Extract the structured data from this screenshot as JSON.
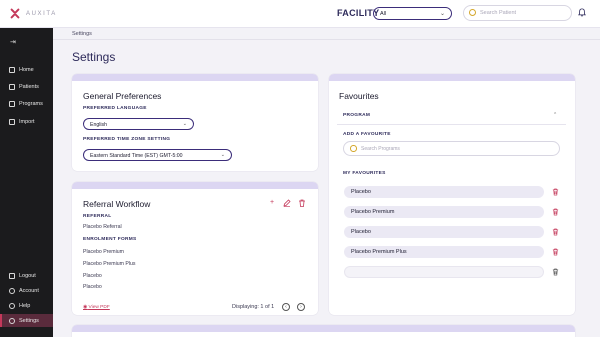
{
  "app": {
    "logo_text": "AUXITA"
  },
  "header": {
    "facility_label": "FACILITY",
    "facility_value": "All",
    "search_placeholder": "Search Patient"
  },
  "sidebar": {
    "items": [
      {
        "label": "Home"
      },
      {
        "label": "Patients"
      },
      {
        "label": "Programs"
      },
      {
        "label": "Import"
      }
    ],
    "bottom_items": [
      {
        "label": "Logout"
      },
      {
        "label": "Account"
      },
      {
        "label": "Help"
      },
      {
        "label": "Settings",
        "active": true
      }
    ]
  },
  "breadcrumb": "Settings",
  "page_title": "Settings",
  "general": {
    "title": "General Preferences",
    "language_label": "PREFERRED LANGUAGE",
    "language_value": "English",
    "timezone_label": "PREFERRED TIME ZONE SETTING",
    "timezone_value": "Eastern Standard Time (EST) GMT-5:00"
  },
  "referral": {
    "title": "Referral Workflow",
    "referral_label": "REFERRAL",
    "referral_value": "Placebo Referral",
    "forms_label": "ENROLMENT FORMS",
    "forms": [
      "Placebo Premium",
      "Placebo Premium Plus",
      "Placebo",
      "Placebo"
    ],
    "view_pdf": "View PDF",
    "displaying": "Displaying: 1 of 1"
  },
  "favourites": {
    "title": "Favourites",
    "program_label": "PROGRAM",
    "add_label": "ADD A FAVOURITE",
    "search_placeholder": "Search Programs",
    "my_label": "MY FAVOURITES",
    "items": [
      "Placebo",
      "Placebo Premium",
      "Placebo",
      "Placebo Premium Plus",
      ""
    ]
  },
  "colors": {
    "accent": "#c4385a",
    "primary": "#2d2a5a",
    "band": "#dcd6f2"
  }
}
